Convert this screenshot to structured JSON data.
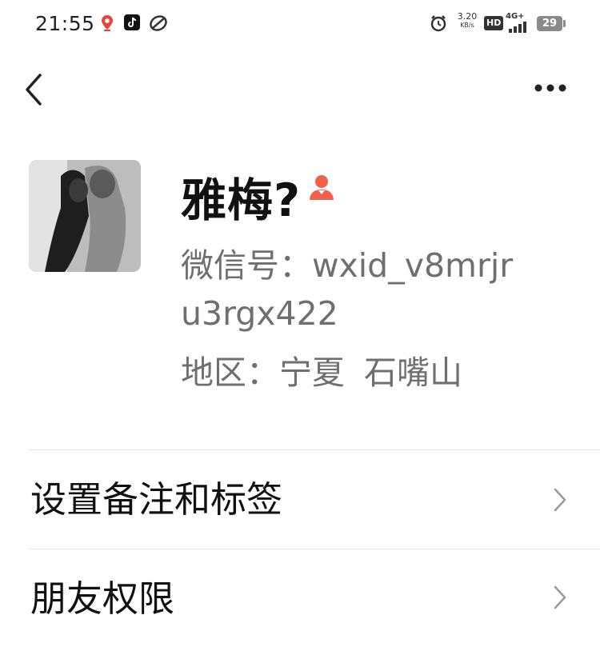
{
  "status_bar": {
    "time": "21:55",
    "net_speed_value": "3.20",
    "net_speed_unit": "KB/s",
    "hd_label": "HD",
    "network_type": "4G+",
    "battery_level": "29"
  },
  "nav": {
    "back_icon": "chevron-left-icon",
    "more_icon": "more-dots-icon"
  },
  "profile": {
    "name": "雅梅?",
    "gender_icon": "person-icon",
    "accent_color": "#f0604b",
    "wechat_id_line1": "微信号：wxid_v8mrjr",
    "wechat_id_line2": "u3rgx422",
    "region_label": "地区：宁夏",
    "region_city": "石嘴山"
  },
  "menu": {
    "items": [
      {
        "label": "设置备注和标签"
      },
      {
        "label": "朋友权限"
      }
    ]
  }
}
